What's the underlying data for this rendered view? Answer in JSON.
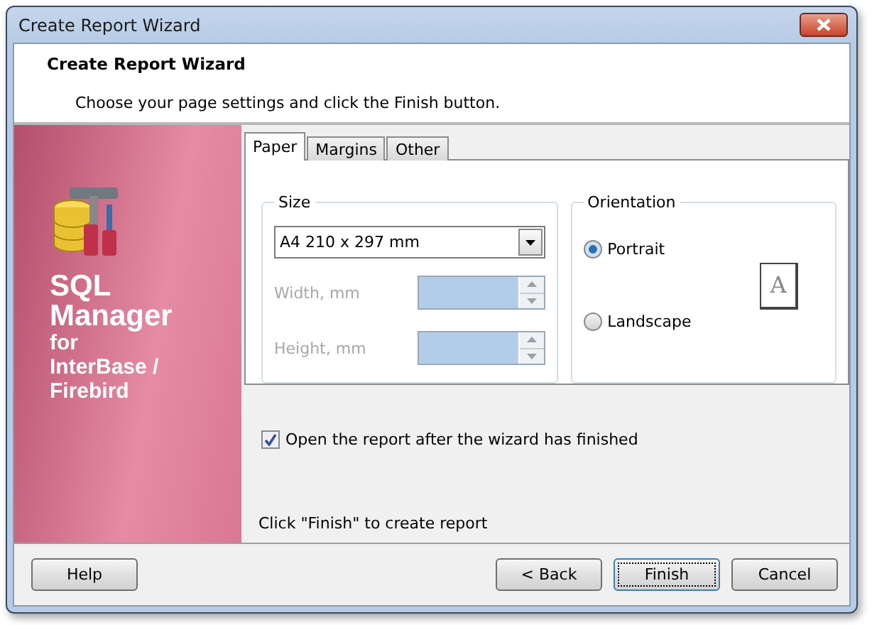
{
  "window": {
    "title": "Create Report Wizard"
  },
  "header": {
    "title": "Create Report Wizard",
    "subtitle": "Choose your page settings and click the Finish button."
  },
  "banner": {
    "lines": [
      "SQL",
      "Manager",
      "for",
      "InterBase /",
      "Firebird"
    ]
  },
  "tabs": [
    {
      "label": "Paper",
      "selected": true
    },
    {
      "label": "Margins",
      "selected": false
    },
    {
      "label": "Other",
      "selected": false
    }
  ],
  "size": {
    "legend": "Size",
    "paper": "A4 210 x 297 mm",
    "fields": [
      {
        "label": "Width, mm",
        "disabled": true
      },
      {
        "label": "Height, mm",
        "disabled": true
      }
    ]
  },
  "orientation": {
    "legend": "Orientation",
    "options": [
      {
        "label": "Portrait",
        "selected": true
      },
      {
        "label": "Landscape",
        "selected": false
      }
    ],
    "preview": "A"
  },
  "open_report": {
    "label": "Open the report after the wizard has finished",
    "checked": true
  },
  "hint": "Click \"Finish\" to create report",
  "buttons": [
    {
      "label": "Help",
      "kind": "help",
      "default": false
    },
    {
      "label": "< Back",
      "kind": "nav",
      "default": false
    },
    {
      "label": "Finish",
      "kind": "nav",
      "default": true
    },
    {
      "label": "Cancel",
      "kind": "nav",
      "default": false
    }
  ]
}
